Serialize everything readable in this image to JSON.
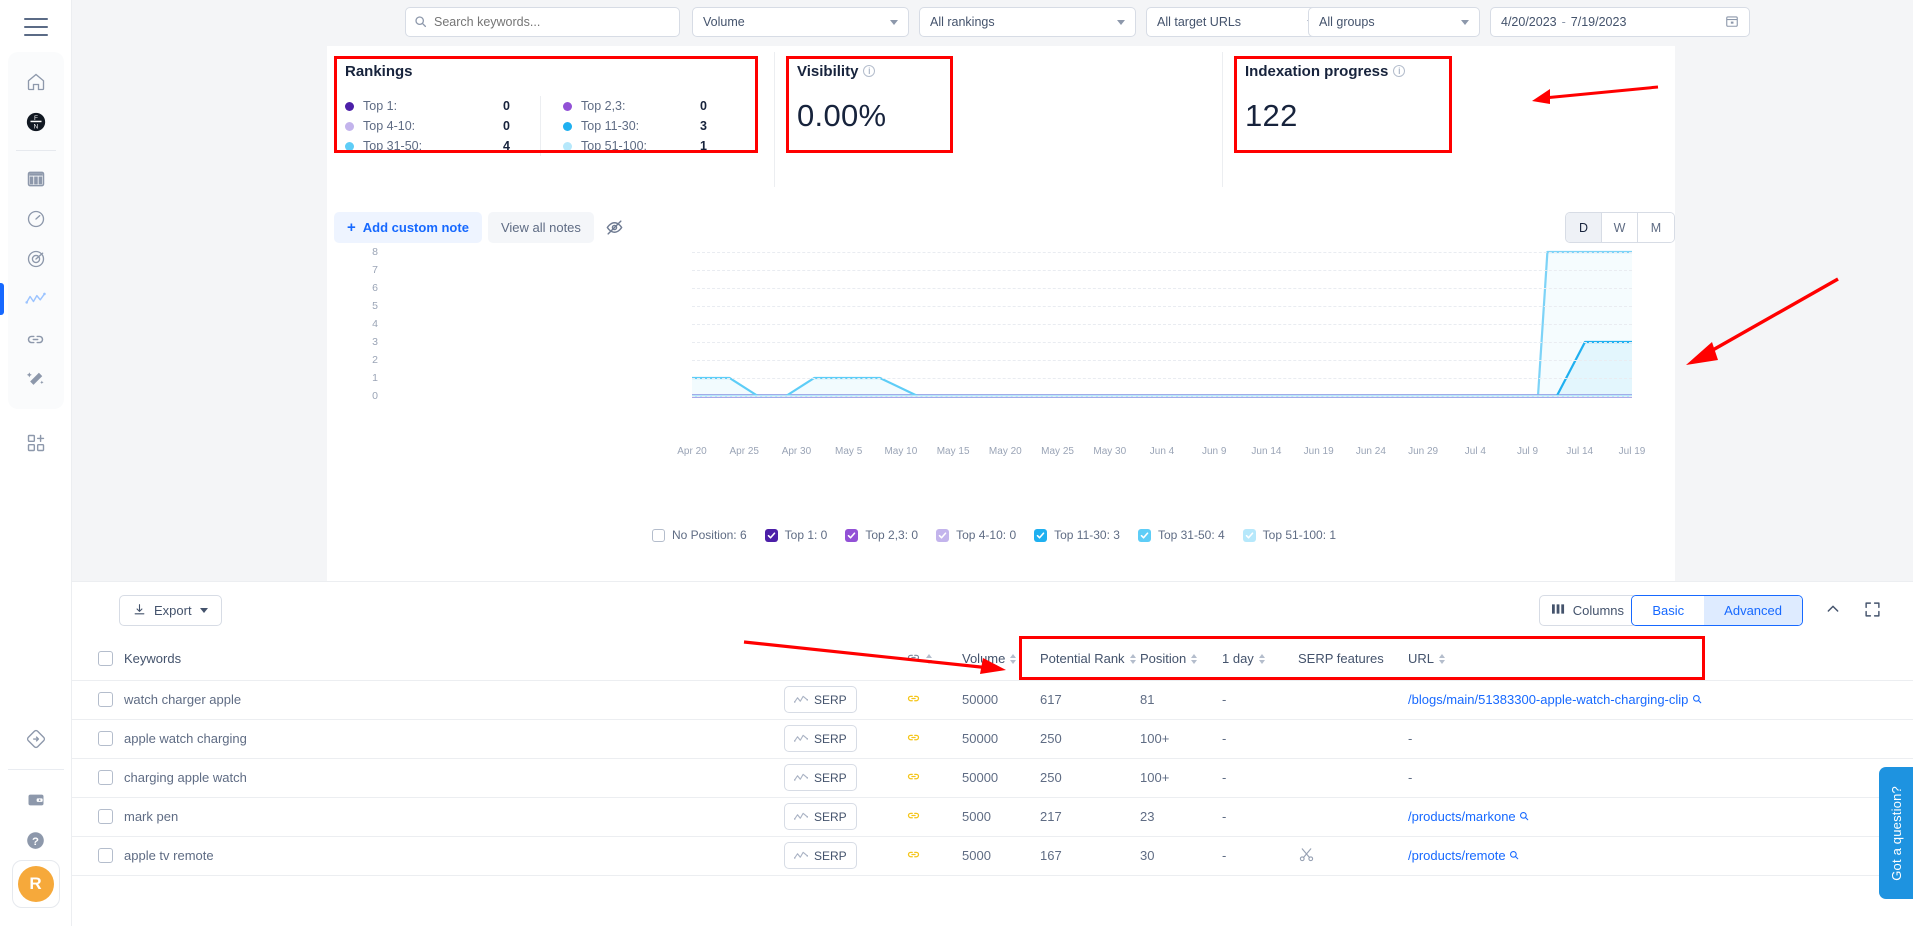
{
  "sidebar": {
    "menu_icon": "hamburger-menu-icon",
    "items": [
      {
        "name": "home",
        "icon": "home-icon",
        "active": false
      },
      {
        "name": "black-badge",
        "icon": "black-badge-icon",
        "active": false
      },
      {
        "name": "table",
        "icon": "table-icon",
        "active": false
      },
      {
        "name": "speedometer",
        "icon": "speedometer-icon",
        "active": false
      },
      {
        "name": "radar",
        "icon": "radar-icon",
        "active": false
      },
      {
        "name": "rank-tracking",
        "icon": "chart-line-icon",
        "active": true
      },
      {
        "name": "backlinks",
        "icon": "link-icon",
        "active": false
      },
      {
        "name": "magic-wand",
        "icon": "magic-wand-icon",
        "active": false
      },
      {
        "name": "add-apps",
        "icon": "grid-plus-icon",
        "active": false
      }
    ],
    "bottom_items": [
      {
        "name": "diamond",
        "icon": "diamond-arrow-icon"
      },
      {
        "name": "wallet",
        "icon": "wallet-icon"
      },
      {
        "name": "help",
        "icon": "question-circle-icon"
      }
    ],
    "avatar_initial": "R"
  },
  "filters": {
    "search_placeholder": "Search keywords...",
    "search_value": "",
    "search_icon": "search-icon",
    "volume": "Volume",
    "rankings": "All rankings",
    "target_urls": "All target URLs",
    "groups": "All groups",
    "date_from": "4/20/2023",
    "date_to": "7/19/2023",
    "date_separator": "-",
    "calendar_icon": "calendar-icon"
  },
  "rankings_card": {
    "title": "Rankings",
    "rows_left": [
      {
        "label": "Top 1:",
        "value": "0",
        "color": "#4c1fa8"
      },
      {
        "label": "Top 4-10:",
        "value": "0",
        "color": "#c3b4ec"
      },
      {
        "label": "Top 31-50:",
        "value": "4",
        "color": "#5ecdf7"
      }
    ],
    "rows_right": [
      {
        "label": "Top 2,3:",
        "value": "0",
        "color": "#9251d6"
      },
      {
        "label": "Top 11-30:",
        "value": "3",
        "color": "#1fb0f0"
      },
      {
        "label": "Top 51-100:",
        "value": "1",
        "color": "#b6e8fb"
      }
    ]
  },
  "visibility_card": {
    "title": "Visibility",
    "info_icon": "info-icon",
    "value": "0.00%"
  },
  "indexation_card": {
    "title": "Indexation progress",
    "info_icon": "info-icon",
    "value": "122"
  },
  "notes": {
    "add_label": "Add custom note",
    "plus_icon": "plus-icon",
    "view_label": "View all notes",
    "eye_icon": "eye-off-icon"
  },
  "granularity": {
    "options": [
      "D",
      "W",
      "M"
    ],
    "selected": "D"
  },
  "chart_data": {
    "type": "line",
    "title": "",
    "xlabel": "",
    "ylabel": "",
    "ylim": [
      0,
      8
    ],
    "yticks": [
      "0",
      "1",
      "2",
      "3",
      "4",
      "5",
      "6",
      "7",
      "8"
    ],
    "grid": true,
    "legend_position": "bottom",
    "xticks": [
      "Apr 20",
      "Apr 25",
      "Apr 30",
      "May 5",
      "May 10",
      "May 15",
      "May 20",
      "May 25",
      "May 30",
      "Jun 4",
      "Jun 9",
      "Jun 14",
      "Jun 19",
      "Jun 24",
      "Jun 29",
      "Jul 4",
      "Jul 9",
      "Jul 14",
      "Jul 19"
    ],
    "series": [
      {
        "name": "No Position",
        "count": 6,
        "color": "#ffffff",
        "checked": false,
        "points": [
          [
            0,
            0
          ],
          [
            90,
            0
          ],
          [
            91,
            8
          ],
          [
            100,
            8
          ]
        ]
      },
      {
        "name": "Top 1",
        "count": 0,
        "color": "#4c1fa8",
        "checked": true,
        "points": [
          [
            0,
            0
          ],
          [
            100,
            0
          ]
        ]
      },
      {
        "name": "Top 2,3",
        "count": 0,
        "color": "#9251d6",
        "checked": true,
        "points": [
          [
            0,
            0
          ],
          [
            100,
            0
          ]
        ]
      },
      {
        "name": "Top 4-10",
        "count": 0,
        "color": "#c3b4ec",
        "checked": true,
        "points": [
          [
            0,
            0
          ],
          [
            100,
            0
          ]
        ]
      },
      {
        "name": "Top 11-30",
        "count": 3,
        "color": "#1fb0f0",
        "checked": true,
        "points": [
          [
            0,
            0
          ],
          [
            92,
            0
          ],
          [
            95,
            3
          ],
          [
            100,
            3
          ]
        ]
      },
      {
        "name": "Top 31-50",
        "count": 4,
        "color": "#5ecdf7",
        "checked": true,
        "points": [
          [
            0,
            1
          ],
          [
            4,
            1
          ],
          [
            7,
            0
          ],
          [
            10,
            0
          ],
          [
            13,
            1
          ],
          [
            20,
            1
          ],
          [
            24,
            0
          ],
          [
            100,
            0
          ]
        ]
      },
      {
        "name": "Top 51-100",
        "count": 1,
        "color": "#b6e8fb",
        "checked": true,
        "points": [
          [
            0,
            0
          ],
          [
            100,
            0
          ]
        ]
      }
    ],
    "legend": [
      {
        "label": "No Position: 6",
        "color": "#ffffff",
        "checked": false
      },
      {
        "label": "Top 1: 0",
        "color": "#4c1fa8",
        "checked": true
      },
      {
        "label": "Top 2,3: 0",
        "color": "#9251d6",
        "checked": true
      },
      {
        "label": "Top 4-10: 0",
        "color": "#c3b4ec",
        "checked": true
      },
      {
        "label": "Top 11-30: 3",
        "color": "#1fb0f0",
        "checked": true
      },
      {
        "label": "Top 31-50: 4",
        "color": "#5ecdf7",
        "checked": true
      },
      {
        "label": "Top 51-100: 1",
        "color": "#b6e8fb",
        "checked": true
      }
    ]
  },
  "table_toolbar": {
    "export_label": "Export",
    "export_icon": "download-icon",
    "columns_label": "Columns",
    "columns_icon": "columns-icon",
    "view_modes": [
      "Basic",
      "Advanced"
    ],
    "view_selected": "Advanced",
    "collapse_icon": "chevron-up-icon",
    "expand_icon": "fullscreen-icon"
  },
  "table": {
    "headers": {
      "keywords": "Keywords",
      "link": "link-icon",
      "volume": "Volume",
      "potential_rank": "Potential Rank",
      "position": "Position",
      "one_day": "1 day",
      "serp_features": "SERP features",
      "url": "URL"
    },
    "serp_button_label": "SERP",
    "rows": [
      {
        "keyword": "watch charger apple",
        "volume": "50000",
        "potential_rank": "617",
        "position": "81",
        "one_day": "-",
        "serp_feature": "",
        "url": "/blogs/main/51383300-apple-watch-charging-clip"
      },
      {
        "keyword": "apple watch charging",
        "volume": "50000",
        "potential_rank": "250",
        "position": "100+",
        "one_day": "-",
        "serp_feature": "",
        "url": "-"
      },
      {
        "keyword": "charging apple watch",
        "volume": "50000",
        "potential_rank": "250",
        "position": "100+",
        "one_day": "-",
        "serp_feature": "",
        "url": "-"
      },
      {
        "keyword": "mark pen",
        "volume": "5000",
        "potential_rank": "217",
        "position": "23",
        "one_day": "-",
        "serp_feature": "",
        "url": "/products/markone"
      },
      {
        "keyword": "apple tv remote",
        "volume": "5000",
        "potential_rank": "167",
        "position": "30",
        "one_day": "-",
        "serp_feature": "scissors-icon",
        "url": "/products/remote"
      }
    ]
  },
  "chat_widget": {
    "label": "Got a question?",
    "color": "#1e93e0"
  },
  "annotations": {
    "arrow_color": "#ff0000",
    "highlight_color": "#ff0000"
  }
}
